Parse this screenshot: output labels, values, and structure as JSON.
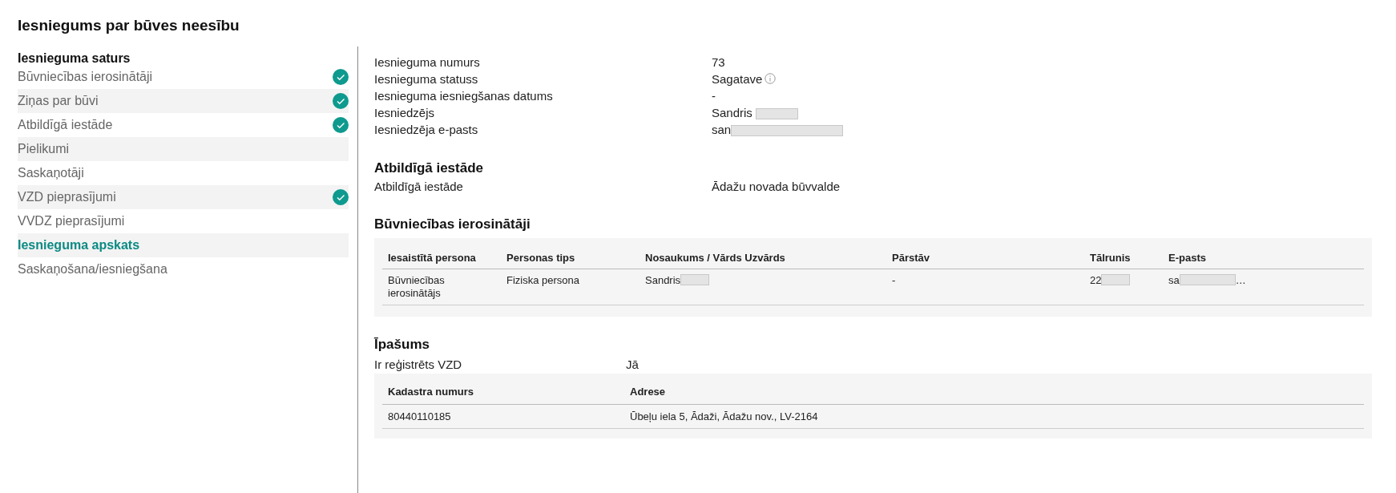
{
  "page_title": "Iesniegums par būves neesību",
  "sidebar": {
    "heading": "Iesnieguma saturs",
    "items": [
      {
        "label": "Būvniecības ierosinātāji",
        "completed": true,
        "selected": false
      },
      {
        "label": "Ziņas par būvi",
        "completed": true,
        "selected": false
      },
      {
        "label": "Atbildīgā iestāde",
        "completed": true,
        "selected": false
      },
      {
        "label": "Pielikumi",
        "completed": false,
        "selected": false
      },
      {
        "label": "Saskaņotāji",
        "completed": false,
        "selected": false
      },
      {
        "label": "VZD pieprasījumi",
        "completed": true,
        "selected": false
      },
      {
        "label": "VVDZ pieprasījumi",
        "completed": false,
        "selected": false
      },
      {
        "label": "Iesnieguma apskats",
        "completed": false,
        "selected": true
      },
      {
        "label": "Saskaņošana/iesniegšana",
        "completed": false,
        "selected": false
      }
    ]
  },
  "summary": [
    {
      "label": "Iesnieguma numurs",
      "value": "73",
      "info": false,
      "redacted": false
    },
    {
      "label": "Iesnieguma statuss",
      "value": "Sagatave",
      "info": true,
      "redacted": false
    },
    {
      "label": "Iesnieguma iesniegšanas datums",
      "value": "-",
      "info": false,
      "redacted": false
    },
    {
      "label": "Iesniedzējs",
      "value": "Sandris",
      "info": false,
      "redacted": true
    },
    {
      "label": "Iesniedzēja e-pasts",
      "value": "san",
      "info": false,
      "redacted": true
    }
  ],
  "authority": {
    "heading": "Atbildīgā iestāde",
    "label": "Atbildīgā iestāde",
    "value": "Ādažu novada būvvalde"
  },
  "initiators": {
    "heading": "Būvniecības ierosinātāji",
    "columns": [
      "Iesaistītā persona",
      "Personas tips",
      "Nosaukums / Vārds Uzvārds",
      "Pārstāv",
      "Tālrunis",
      "E-pasts"
    ],
    "rows": [
      [
        {
          "text": "Būvniecības ierosinātājs",
          "redacted": false
        },
        {
          "text": "Fiziska persona",
          "redacted": false
        },
        {
          "text": "Sandris",
          "redacted": true
        },
        {
          "text": "-",
          "redacted": false
        },
        {
          "text": "22",
          "redacted": true
        },
        {
          "text": "sa",
          "redacted": true,
          "suffix": "…"
        }
      ]
    ]
  },
  "property": {
    "heading": "Īpašums",
    "label": "Ir reģistrēts VZD",
    "value": "Jā",
    "columns": [
      "Kadastra numurs",
      "Adrese"
    ],
    "rows": [
      [
        "80440110185",
        "Ūbeļu iela 5, Ādaži, Ādažu nov., LV-2164"
      ]
    ]
  }
}
